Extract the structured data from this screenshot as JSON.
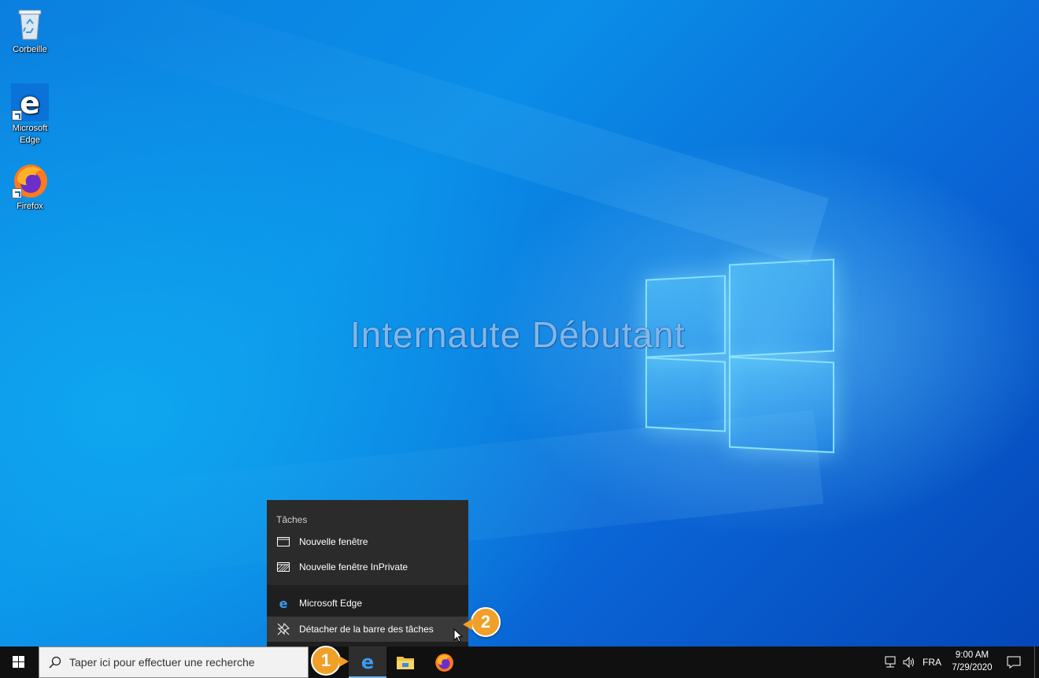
{
  "desktop": {
    "watermark": "Internaute Débutant",
    "icons": [
      {
        "label_line1": "Corbeille",
        "label_line2": ""
      },
      {
        "label_line1": "Microsoft",
        "label_line2": "Edge"
      },
      {
        "label_line1": "Firefox",
        "label_line2": ""
      }
    ]
  },
  "jumplist": {
    "section_title": "Tâches",
    "tasks": [
      {
        "label": "Nouvelle fenêtre",
        "icon": "window-icon"
      },
      {
        "label": "Nouvelle fenêtre InPrivate",
        "icon": "inprivate-window-icon"
      }
    ],
    "app_label": "Microsoft Edge",
    "unpin_label": "Détacher de la barre des tâches"
  },
  "taskbar": {
    "search_placeholder": "Taper ici pour effectuer une recherche",
    "apps": [
      "Microsoft Edge",
      "Explorateur de fichiers",
      "Firefox"
    ],
    "language": "FRA",
    "time": "9:00 AM",
    "date": "7/29/2020"
  },
  "badges": {
    "step1": "1",
    "step2": "2"
  },
  "colors": {
    "accent": "#f0a028",
    "taskbar": "#101010",
    "jumplist": "#2b2b2b",
    "active_indicator": "#76b9ed"
  }
}
